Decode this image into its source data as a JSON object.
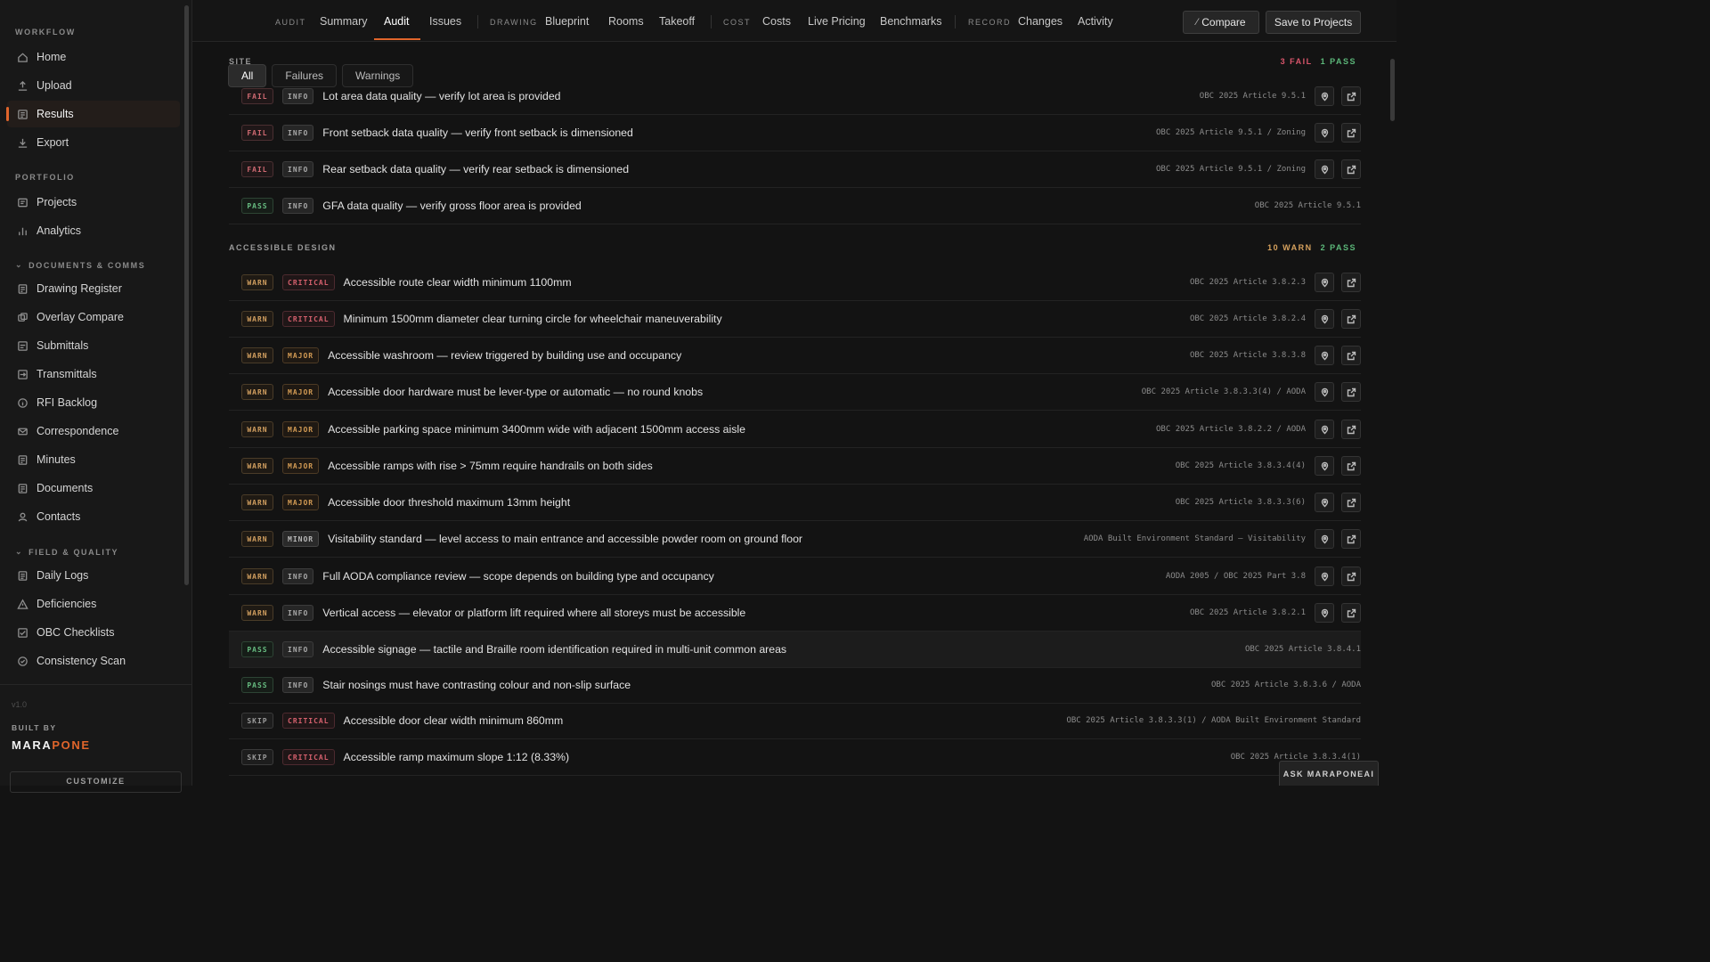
{
  "sidebar": {
    "sections": {
      "workflow": "WORKFLOW",
      "portfolio": "PORTFOLIO",
      "documents": "DOCUMENTS & COMMS",
      "field": "FIELD & QUALITY"
    },
    "workflow_items": [
      {
        "label": "Home",
        "icon": "home-icon"
      },
      {
        "label": "Upload",
        "icon": "upload-icon"
      },
      {
        "label": "Results",
        "icon": "results-icon",
        "active": true
      },
      {
        "label": "Export",
        "icon": "export-icon"
      }
    ],
    "portfolio_items": [
      {
        "label": "Projects",
        "icon": "projects-icon"
      },
      {
        "label": "Analytics",
        "icon": "analytics-icon"
      }
    ],
    "documents_items": [
      {
        "label": "Drawing Register",
        "icon": "document-icon"
      },
      {
        "label": "Overlay Compare",
        "icon": "overlay-icon"
      },
      {
        "label": "Submittals",
        "icon": "submittal-icon"
      },
      {
        "label": "Transmittals",
        "icon": "transmittal-icon"
      },
      {
        "label": "RFI Backlog",
        "icon": "info-icon"
      },
      {
        "label": "Correspondence",
        "icon": "mail-icon"
      },
      {
        "label": "Minutes",
        "icon": "document-icon"
      },
      {
        "label": "Documents",
        "icon": "document-icon"
      },
      {
        "label": "Contacts",
        "icon": "user-icon"
      }
    ],
    "field_items": [
      {
        "label": "Daily Logs",
        "icon": "log-icon"
      },
      {
        "label": "Deficiencies",
        "icon": "warning-icon"
      },
      {
        "label": "OBC Checklists",
        "icon": "checklist-icon"
      },
      {
        "label": "Consistency Scan",
        "icon": "shield-check-icon"
      }
    ],
    "version": "v1.0",
    "built_by": "BUILT BY",
    "brand_a": "MARA",
    "brand_b": "PONE",
    "customize": "CUSTOMIZE"
  },
  "topbar": {
    "groups": [
      {
        "label": "AUDIT",
        "tabs": [
          "Summary",
          "Audit",
          "Issues"
        ]
      },
      {
        "label": "DRAWING",
        "tabs": [
          "Blueprint",
          "Rooms",
          "Takeoff"
        ]
      },
      {
        "label": "COST",
        "tabs": [
          "Costs",
          "Live Pricing",
          "Benchmarks"
        ]
      },
      {
        "label": "RECORD",
        "tabs": [
          "Changes",
          "Activity"
        ]
      }
    ],
    "active_tab": "Audit",
    "compare_label": "Compare",
    "save_label": "Save to Projects"
  },
  "filters": [
    "All",
    "Failures",
    "Warnings"
  ],
  "active_filter": "All",
  "site": {
    "label": "SITE",
    "counts": {
      "fail": "3 FAIL",
      "pass": "1 PASS"
    },
    "rows": [
      {
        "status": "FAIL",
        "severity": "INFO",
        "text": "Lot area data quality — verify lot area is provided",
        "ref": "OBC 2025 Article 9.5.1",
        "actions": true
      },
      {
        "status": "FAIL",
        "severity": "INFO",
        "text": "Front setback data quality — verify front setback is dimensioned",
        "ref": "OBC 2025 Article 9.5.1 / Zoning",
        "actions": true
      },
      {
        "status": "FAIL",
        "severity": "INFO",
        "text": "Rear setback data quality — verify rear setback is dimensioned",
        "ref": "OBC 2025 Article 9.5.1 / Zoning",
        "actions": true
      },
      {
        "status": "PASS",
        "severity": "INFO",
        "text": "GFA data quality — verify gross floor area is provided",
        "ref": "OBC 2025 Article 9.5.1",
        "actions": false
      }
    ]
  },
  "accessible": {
    "label": "ACCESSIBLE DESIGN",
    "counts": {
      "warn": "10 WARN",
      "pass": "2 PASS"
    },
    "rows": [
      {
        "status": "WARN",
        "severity": "CRITICAL",
        "text": "Accessible route clear width minimum 1100mm",
        "ref": "OBC 2025 Article 3.8.2.3",
        "actions": true
      },
      {
        "status": "WARN",
        "severity": "CRITICAL",
        "text": "Minimum 1500mm diameter clear turning circle for wheelchair maneuverability",
        "ref": "OBC 2025 Article 3.8.2.4",
        "actions": true
      },
      {
        "status": "WARN",
        "severity": "MAJOR",
        "text": "Accessible washroom — review triggered by building use and occupancy",
        "ref": "OBC 2025 Article 3.8.3.8",
        "actions": true
      },
      {
        "status": "WARN",
        "severity": "MAJOR",
        "text": "Accessible door hardware must be lever-type or automatic — no round knobs",
        "ref": "OBC 2025 Article 3.8.3.3(4) / AODA",
        "actions": true
      },
      {
        "status": "WARN",
        "severity": "MAJOR",
        "text": "Accessible parking space minimum 3400mm wide with adjacent 1500mm access aisle",
        "ref": "OBC 2025 Article 3.8.2.2 / AODA",
        "actions": true
      },
      {
        "status": "WARN",
        "severity": "MAJOR",
        "text": "Accessible ramps with rise > 75mm require handrails on both sides",
        "ref": "OBC 2025 Article 3.8.3.4(4)",
        "actions": true
      },
      {
        "status": "WARN",
        "severity": "MAJOR",
        "text": "Accessible door threshold maximum 13mm height",
        "ref": "OBC 2025 Article 3.8.3.3(6)",
        "actions": true
      },
      {
        "status": "WARN",
        "severity": "MINOR",
        "text": "Visitability standard — level access to main entrance and accessible powder room on ground floor",
        "ref": "AODA Built Environment Standard — Visitability",
        "actions": true
      },
      {
        "status": "WARN",
        "severity": "INFO",
        "text": "Full AODA compliance review — scope depends on building type and occupancy",
        "ref": "AODA 2005 / OBC 2025 Part 3.8",
        "actions": true
      },
      {
        "status": "WARN",
        "severity": "INFO",
        "text": "Vertical access — elevator or platform lift required where all storeys must be accessible",
        "ref": "OBC 2025 Article 3.8.2.1",
        "actions": true
      },
      {
        "status": "PASS",
        "severity": "INFO",
        "text": "Accessible signage — tactile and Braille room identification required in multi-unit common areas",
        "ref": "OBC 2025 Article 3.8.4.1",
        "actions": false
      },
      {
        "status": "PASS",
        "severity": "INFO",
        "text": "Stair nosings must have contrasting colour and non-slip surface",
        "ref": "OBC 2025 Article 3.8.3.6 / AODA",
        "actions": false
      },
      {
        "status": "SKIP",
        "severity": "CRITICAL",
        "text": "Accessible door clear width minimum 860mm",
        "ref": "OBC 2025 Article 3.8.3.3(1) / AODA Built Environment Standard",
        "actions": false
      },
      {
        "status": "SKIP",
        "severity": "CRITICAL",
        "text": "Accessible ramp maximum slope 1:12 (8.33%)",
        "ref": "OBC 2025 Article 3.8.3.4(1)",
        "actions": false
      }
    ]
  },
  "ask_label": "ASK MARAPONEAI"
}
